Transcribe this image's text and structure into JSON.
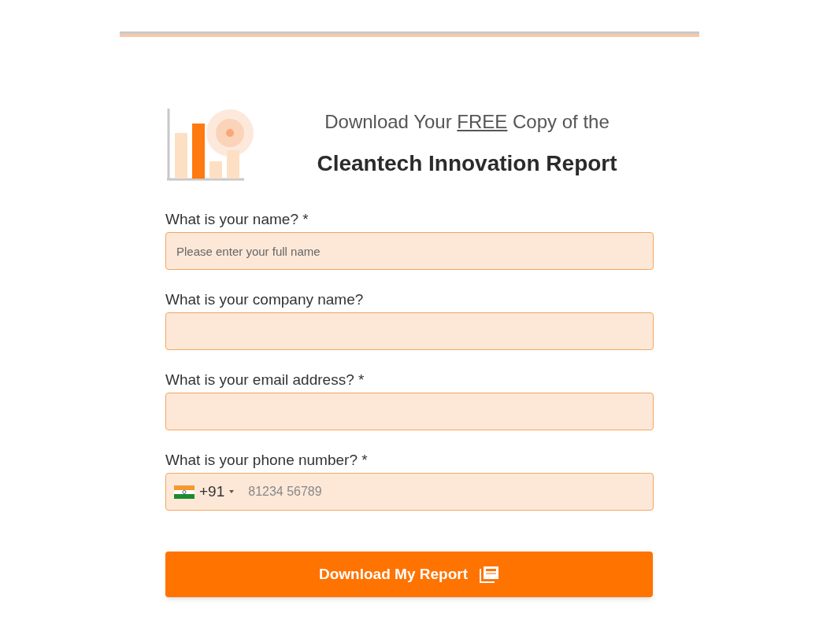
{
  "heading": {
    "intro_before": "Download Your ",
    "intro_emphasis": "FREE",
    "intro_after": " Copy of the",
    "title": "Cleantech Innovation Report"
  },
  "fields": [
    {
      "kind": "text",
      "label": "What is your name? *",
      "placeholder": "Please enter your full name"
    },
    {
      "kind": "text",
      "label": "What is your company name?"
    },
    {
      "kind": "text",
      "label": "What is your email address? *"
    },
    {
      "kind": "phone",
      "label": "What is your phone number? *",
      "dial_code": "+91",
      "placeholder": "81234 56789"
    }
  ],
  "submit": {
    "label": "Download My Report"
  }
}
